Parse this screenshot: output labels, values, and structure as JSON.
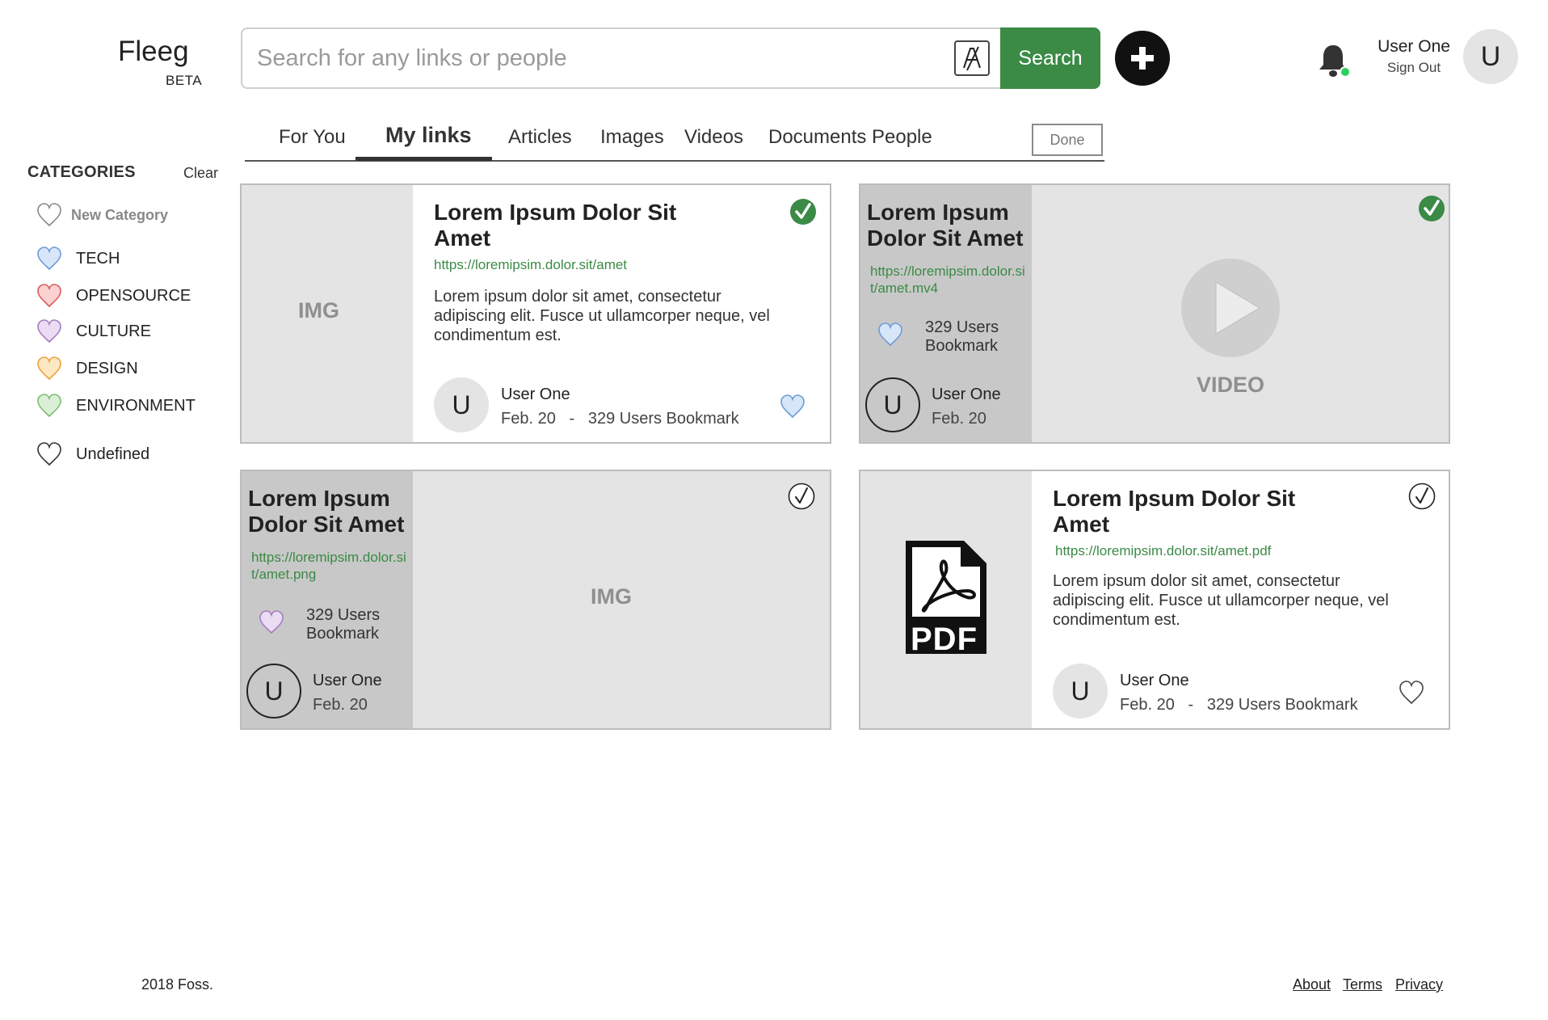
{
  "brand": {
    "name": "Fleeg",
    "badge": "BETA"
  },
  "search": {
    "placeholder": "Search for any links or people",
    "button_label": "Search"
  },
  "user": {
    "name": "User One",
    "sign_out": "Sign Out",
    "initial": "U"
  },
  "tabs": [
    {
      "label": "For You"
    },
    {
      "label": "My links",
      "active": true
    },
    {
      "label": "Articles"
    },
    {
      "label": "Images"
    },
    {
      "label": "Videos"
    },
    {
      "label": "Documents"
    },
    {
      "label": "People"
    }
  ],
  "done_label": "Done",
  "categories": {
    "header": "CATEGORIES",
    "clear": "Clear",
    "new_label": "New Category",
    "items": [
      {
        "label": "TECH",
        "color": "#9fc3ef"
      },
      {
        "label": "OPENSOURCE",
        "color": "#f08a8a"
      },
      {
        "label": "CULTURE",
        "color": "#c9a9dc"
      },
      {
        "label": "DESIGN",
        "color": "#f4c06a"
      },
      {
        "label": "ENVIRONMENT",
        "color": "#a8d8a0"
      }
    ],
    "undefined_label": "Undefined"
  },
  "cards": [
    {
      "type": "article",
      "media_label": "IMG",
      "title": "Lorem Ipsum Dolor Sit Amet",
      "url": "https://loremipsim.dolor.sit/amet",
      "description": "Lorem ipsum dolor sit amet, consectetur adipiscing elit. Fusce ut ullamcorper neque, vel condimentum est.",
      "author": "User One",
      "date": "Feb. 20",
      "separator": "-",
      "bookmarks": "329 Users Bookmark",
      "selected": true,
      "heart_color": "#9fc3ef"
    },
    {
      "type": "video",
      "media_label": "VIDEO",
      "title": "Lorem Ipsum Dolor Sit Amet",
      "url": "https://loremipsim.dolor.sit/amet.mv4",
      "bookmarks": "329 Users Bookmark",
      "author": "User One",
      "date": "Feb. 20",
      "selected": true,
      "heart_color": "#9fc3ef"
    },
    {
      "type": "image",
      "media_label": "IMG",
      "title": "Lorem Ipsum Dolor Sit Amet",
      "url": "https://loremipsim.dolor.sit/amet.png",
      "bookmarks": "329 Users Bookmark",
      "author": "User One",
      "date": "Feb. 20",
      "selected": false,
      "heart_color": "#c9a9dc"
    },
    {
      "type": "document",
      "media_label": "PDF",
      "title": "Lorem Ipsum Dolor Sit Amet",
      "url": "https://loremipsim.dolor.sit/amet.pdf",
      "description": "Lorem ipsum dolor sit amet, consectetur adipiscing elit. Fusce ut ullamcorper neque, vel condimentum est.",
      "author": "User One",
      "date": "Feb. 20",
      "separator": "-",
      "bookmarks": "329 Users Bookmark",
      "selected": false,
      "heart_color": "#ffffff"
    }
  ],
  "footer": {
    "copyright": "2018 Foss.",
    "links": [
      "About",
      "Terms",
      "Privacy"
    ]
  },
  "colors": {
    "accent": "#3b8a46",
    "panel_dark": "#c8c8c8",
    "panel_light": "#e4e4e4",
    "online": "#2fcf5c"
  }
}
